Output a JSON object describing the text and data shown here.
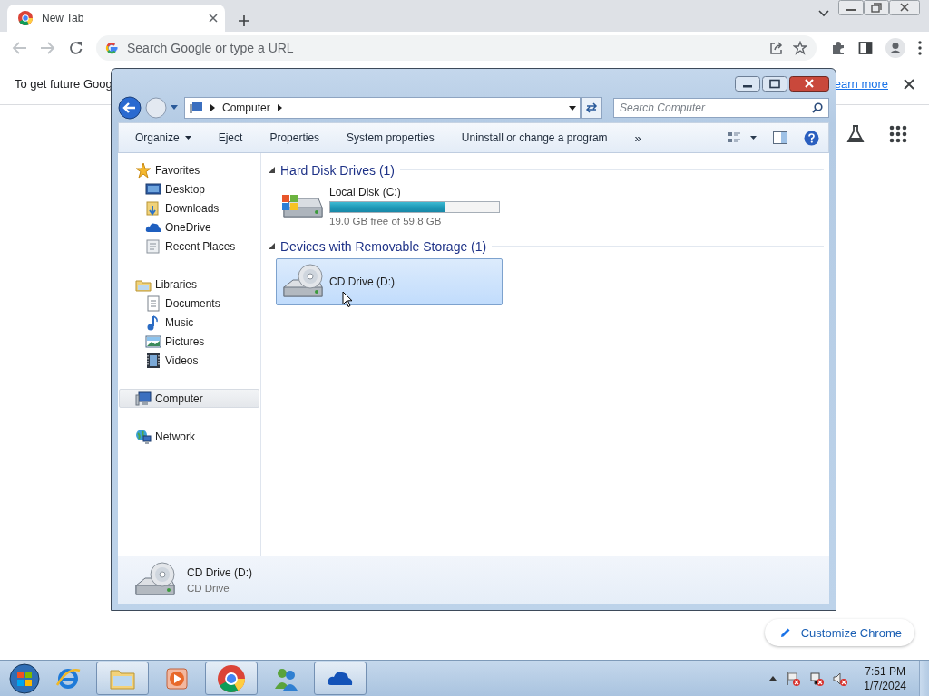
{
  "browser": {
    "tab": {
      "title": "New Tab",
      "selected": true
    },
    "omnibox": {
      "placeholder": "Search Google or type a URL"
    },
    "infobar": {
      "text": "To get future Goog",
      "link": "earn more"
    },
    "customize_button": "Customize Chrome"
  },
  "explorer": {
    "breadcrumb": [
      "Computer"
    ],
    "search": {
      "placeholder": "Search Computer"
    },
    "commands": [
      {
        "label": "Organize",
        "dropdown": true
      },
      {
        "label": "Eject",
        "dropdown": false
      },
      {
        "label": "Properties",
        "dropdown": false
      },
      {
        "label": "System properties",
        "dropdown": false
      },
      {
        "label": "Uninstall or change a program",
        "dropdown": false
      }
    ],
    "more": "»",
    "nav": [
      {
        "label": "Favorites",
        "selected": false,
        "children": [
          {
            "label": "Desktop",
            "selected": false
          },
          {
            "label": "Downloads",
            "selected": false
          },
          {
            "label": "OneDrive",
            "selected": false
          },
          {
            "label": "Recent Places",
            "selected": false
          }
        ]
      },
      {
        "label": "Libraries",
        "selected": false,
        "children": [
          {
            "label": "Documents",
            "selected": false
          },
          {
            "label": "Music",
            "selected": false
          },
          {
            "label": "Pictures",
            "selected": false
          },
          {
            "label": "Videos",
            "selected": false
          }
        ]
      },
      {
        "label": "Computer",
        "selected": true
      },
      {
        "label": "Network",
        "selected": false
      }
    ],
    "groups": [
      {
        "title": "Hard Disk Drives (1)",
        "expanded": true,
        "items": [
          {
            "kind": "disk",
            "name": "Local Disk (C:)",
            "level": 0.68,
            "reading": "19.0 GB free of 59.8 GB",
            "selected": false
          }
        ]
      },
      {
        "title": "Devices with Removable Storage (1)",
        "expanded": true,
        "items": [
          {
            "kind": "cd",
            "name": "CD Drive (D:)",
            "selected": true
          }
        ]
      }
    ],
    "details": {
      "kind": "cd",
      "name": "CD Drive (D:)",
      "type": "CD Drive"
    }
  },
  "taskbar": {
    "apps": [
      {
        "running": true
      },
      {
        "running": false
      },
      {
        "running": true
      },
      {
        "running": false
      },
      {
        "running": true
      }
    ],
    "time": "7:51 PM",
    "date": "1/7/2024"
  }
}
